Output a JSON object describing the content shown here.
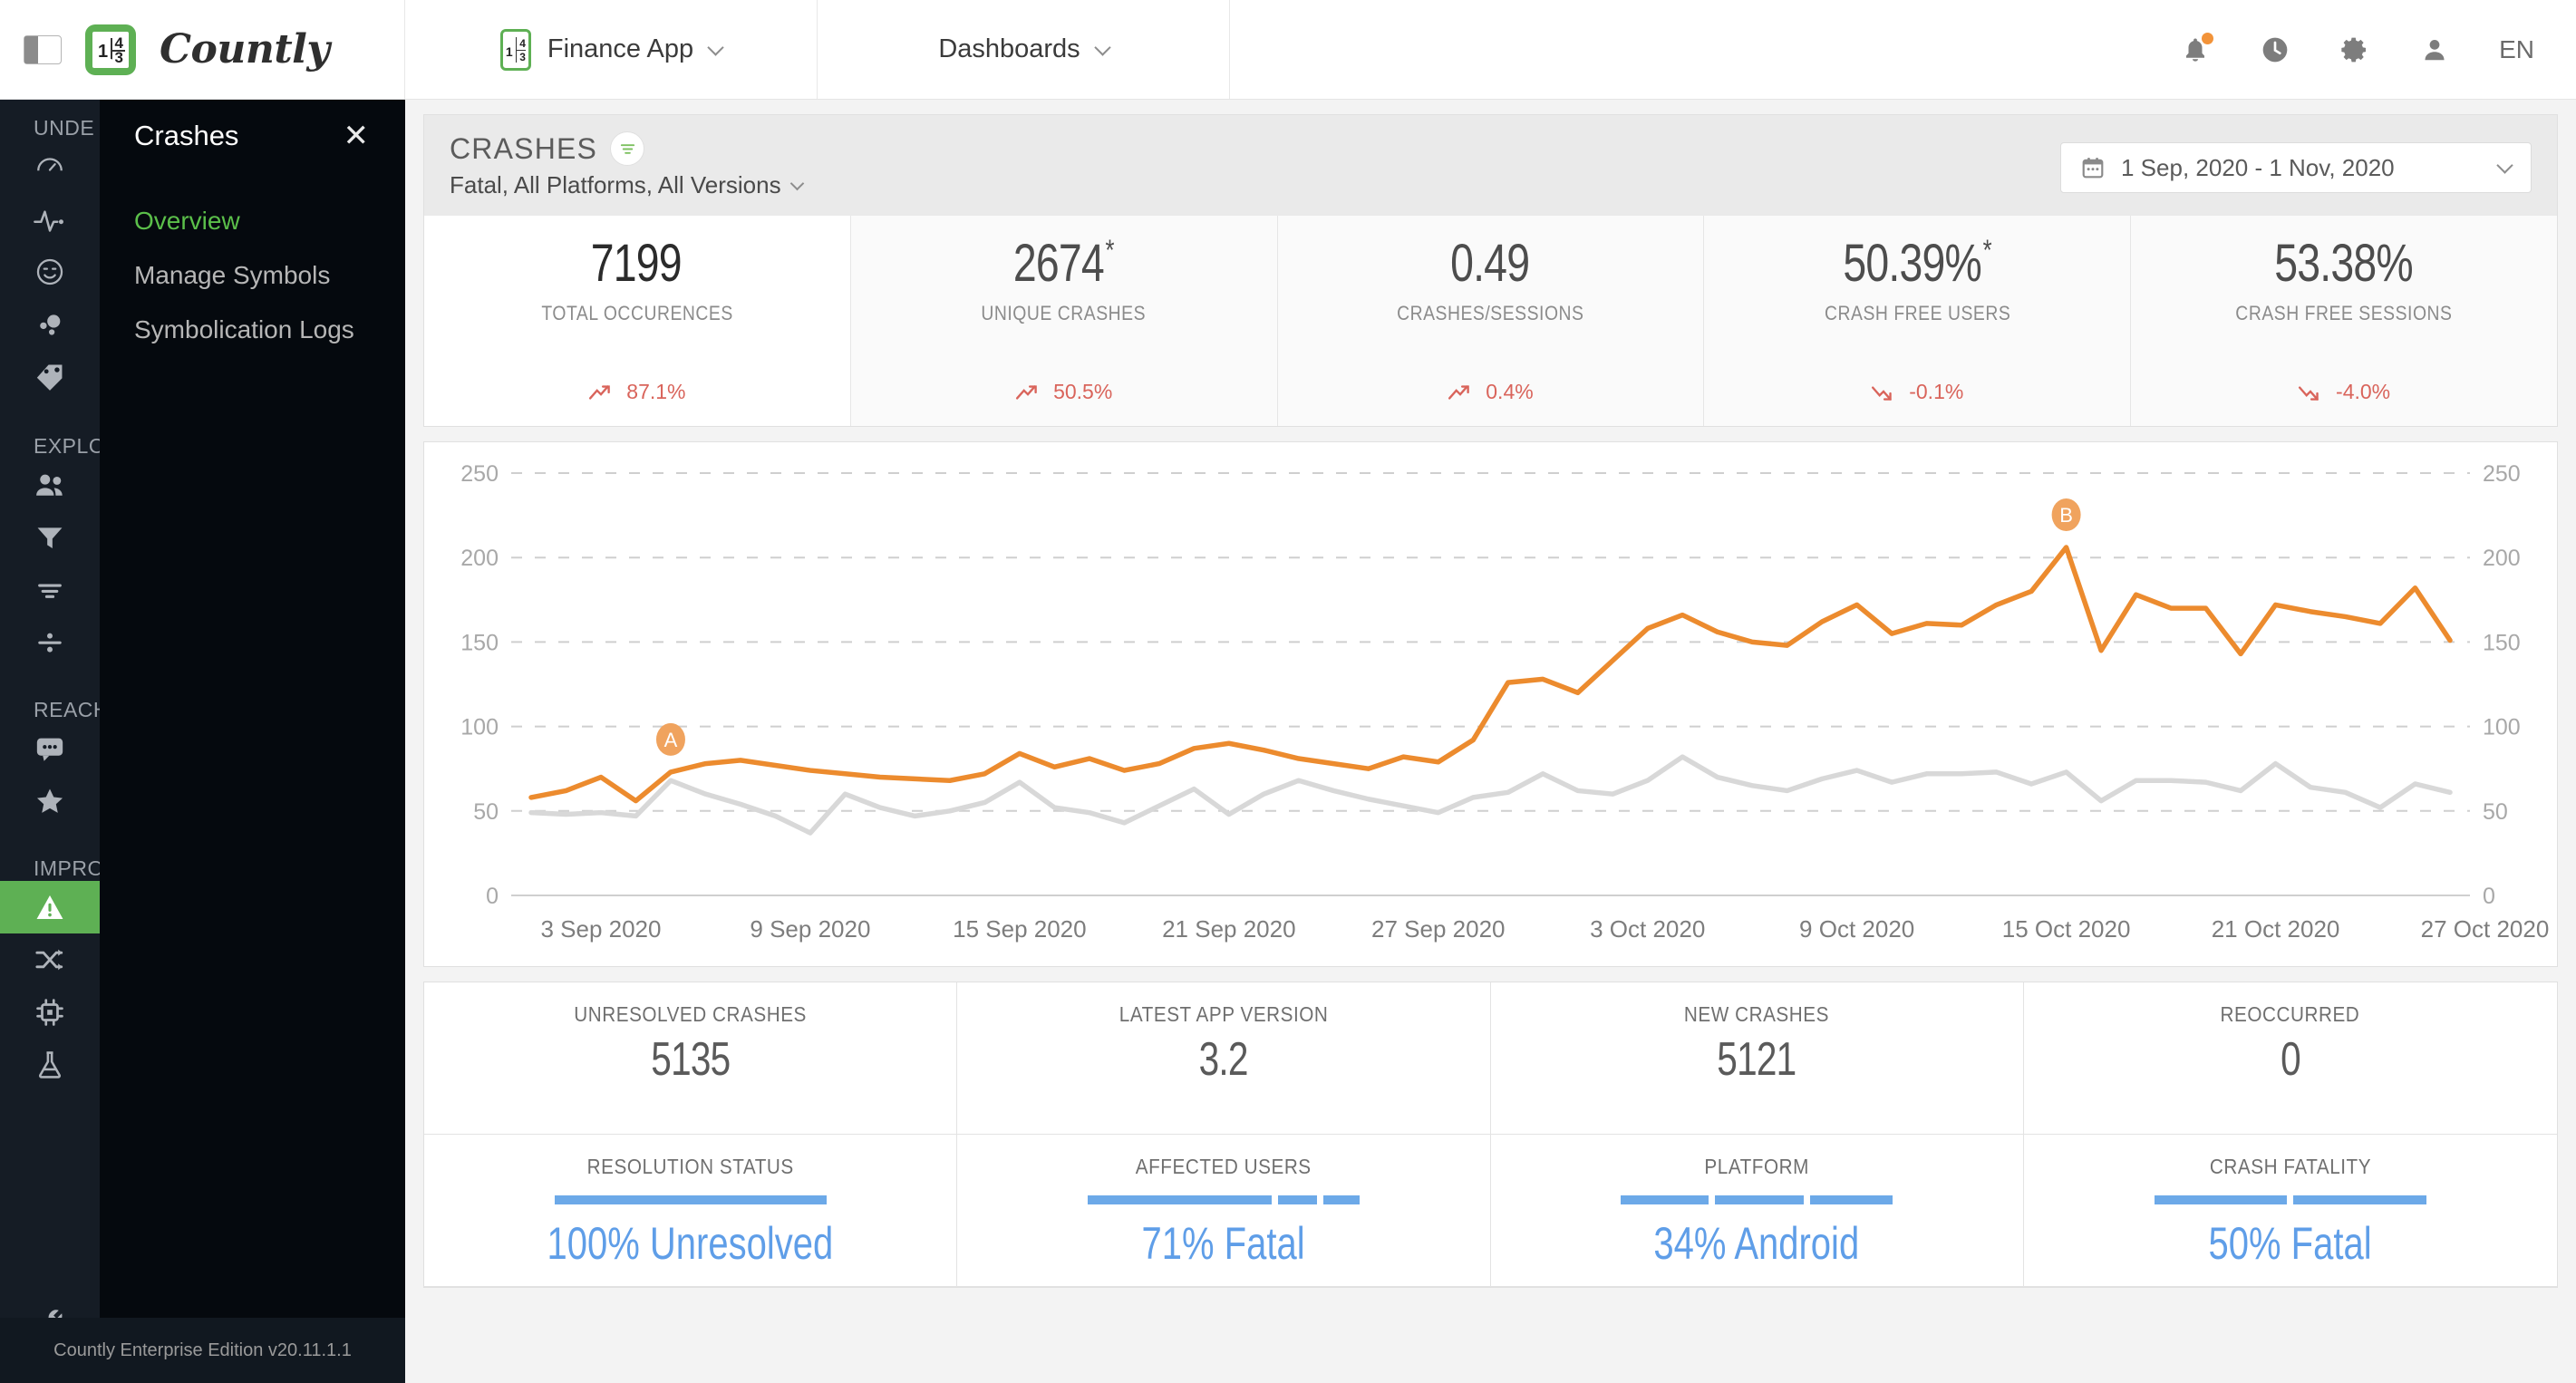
{
  "topbar": {
    "panel_toggle_icon": "panel-toggle-icon",
    "logo_text": "Countly",
    "app_selector": {
      "label": "Finance App",
      "icon": "app-logo-icon"
    },
    "dashboards_selector": {
      "label": "Dashboards"
    },
    "icons": [
      {
        "name": "bell-icon",
        "has_badge": true
      },
      {
        "name": "clock-icon",
        "has_badge": false
      },
      {
        "name": "gear-icon",
        "has_badge": false
      },
      {
        "name": "user-icon",
        "has_badge": false
      }
    ],
    "language": "EN"
  },
  "sidebar": {
    "sections": [
      {
        "label": "UNDE",
        "icons": [
          "gauge-icon",
          "pulse-icon",
          "smiley-icon",
          "bubbles-icon",
          "tag-icon"
        ]
      },
      {
        "label": "EXPLO",
        "icons": [
          "people-icon",
          "funnel-icon",
          "flow-icon",
          "divide-icon"
        ]
      },
      {
        "label": "REACH",
        "icons": [
          "chat-icon",
          "star-icon"
        ]
      },
      {
        "label": "IMPRO",
        "icons": [
          "warning-icon",
          "ab-split-icon",
          "chip-icon",
          "flask-icon"
        ]
      }
    ],
    "active_icon": "warning-icon",
    "bottom_icon": "wrench-icon",
    "footer": "Countly Enterprise Edition v20.11.1.1"
  },
  "flyout": {
    "title": "Crashes",
    "close_icon": "close-icon",
    "items": [
      {
        "label": "Overview",
        "active": true
      },
      {
        "label": "Manage Symbols",
        "active": false
      },
      {
        "label": "Symbolication Logs",
        "active": false
      }
    ]
  },
  "page_header": {
    "title": "CRASHES",
    "filter_icon": "filter-icon",
    "subtitle": "Fatal, All Platforms, All Versions",
    "subtitle_chevron": "chevron-down-icon",
    "date_range": "1 Sep, 2020 - 1 Nov, 2020",
    "calendar_icon": "calendar-icon",
    "date_chevron": "chevron-down-icon"
  },
  "kpis": [
    {
      "value": "7199",
      "sup": "",
      "label": "TOTAL OCCURENCES",
      "trend": "87.1%",
      "direction": "up"
    },
    {
      "value": "2674",
      "sup": "*",
      "label": "UNIQUE CRASHES",
      "trend": "50.5%",
      "direction": "up"
    },
    {
      "value": "0.49",
      "sup": "",
      "label": "CRASHES/SESSIONS",
      "trend": "0.4%",
      "direction": "up"
    },
    {
      "value": "50.39%",
      "sup": "*",
      "label": "CRASH FREE USERS",
      "trend": "-0.1%",
      "direction": "down"
    },
    {
      "value": "53.38%",
      "sup": "",
      "label": "CRASH FREE SESSIONS",
      "trend": "-4.0%",
      "direction": "down"
    }
  ],
  "chart_data": {
    "type": "line",
    "title": "",
    "xlabel": "",
    "ylabel": "",
    "ylim": [
      0,
      250
    ],
    "yticks": [
      0,
      50,
      100,
      150,
      200,
      250
    ],
    "grid": true,
    "legend_position": "none",
    "dual_axis": true,
    "annotations": [
      {
        "label": "A",
        "index": 4,
        "color": "#f0a35e"
      },
      {
        "label": "B",
        "index": 44,
        "color": "#f0a35e"
      }
    ],
    "tick_labels": [
      "3 Sep 2020",
      "9 Sep 2020",
      "15 Sep 2020",
      "21 Sep 2020",
      "27 Sep 2020",
      "3 Oct 2020",
      "9 Oct 2020",
      "15 Oct 2020",
      "21 Oct 2020",
      "27 Oct 2020"
    ],
    "tick_indices": [
      2,
      8,
      14,
      20,
      26,
      32,
      38,
      44,
      50,
      56
    ],
    "series": [
      {
        "name": "Total Occurences",
        "color": "#ec8b2e",
        "values": [
          58,
          62,
          70,
          56,
          73,
          78,
          80,
          77,
          74,
          72,
          70,
          69,
          68,
          72,
          84,
          76,
          81,
          74,
          78,
          87,
          90,
          86,
          81,
          78,
          75,
          82,
          79,
          92,
          126,
          128,
          120,
          139,
          158,
          166,
          156,
          150,
          148,
          162,
          172,
          155,
          161,
          160,
          172,
          180,
          206,
          145,
          178,
          170,
          170,
          143,
          172,
          168,
          165,
          161,
          182,
          151
        ]
      },
      {
        "name": "Unique Crashes",
        "color": "#d8d8d8",
        "values": [
          49,
          48,
          49,
          47,
          68,
          60,
          54,
          47,
          37,
          60,
          52,
          47,
          50,
          55,
          67,
          52,
          49,
          43,
          53,
          63,
          48,
          60,
          68,
          62,
          57,
          53,
          49,
          58,
          61,
          72,
          62,
          60,
          68,
          82,
          70,
          65,
          62,
          69,
          74,
          67,
          72,
          72,
          73,
          66,
          73,
          56,
          68,
          68,
          67,
          62,
          78,
          64,
          61,
          52,
          66,
          61
        ]
      }
    ]
  },
  "bottom_cards": {
    "row1": [
      {
        "label": "UNRESOLVED CRASHES",
        "value": "5135"
      },
      {
        "label": "LATEST APP VERSION",
        "value": "3.2"
      },
      {
        "label": "NEW CRASHES",
        "value": "5121"
      },
      {
        "label": "REOCCURRED",
        "value": "0"
      }
    ],
    "row2": [
      {
        "label": "RESOLUTION STATUS",
        "percent": "100% Unresolved",
        "segments": [
          100
        ]
      },
      {
        "label": "AFFECTED USERS",
        "percent": "71% Fatal",
        "segments": [
          71,
          15,
          14
        ]
      },
      {
        "label": "PLATFORM",
        "percent": "34% Android",
        "segments": [
          34,
          34,
          32
        ]
      },
      {
        "label": "CRASH FATALITY",
        "percent": "50% Fatal",
        "segments": [
          50,
          50
        ]
      }
    ]
  },
  "colors": {
    "brand_green": "#5eb054",
    "accent_orange": "#ec8b2e",
    "accent_blue": "#6ca9e8",
    "trend_red": "#d9645b",
    "sidebar_bg": "#151c25",
    "flyout_bg": "#05090e"
  }
}
